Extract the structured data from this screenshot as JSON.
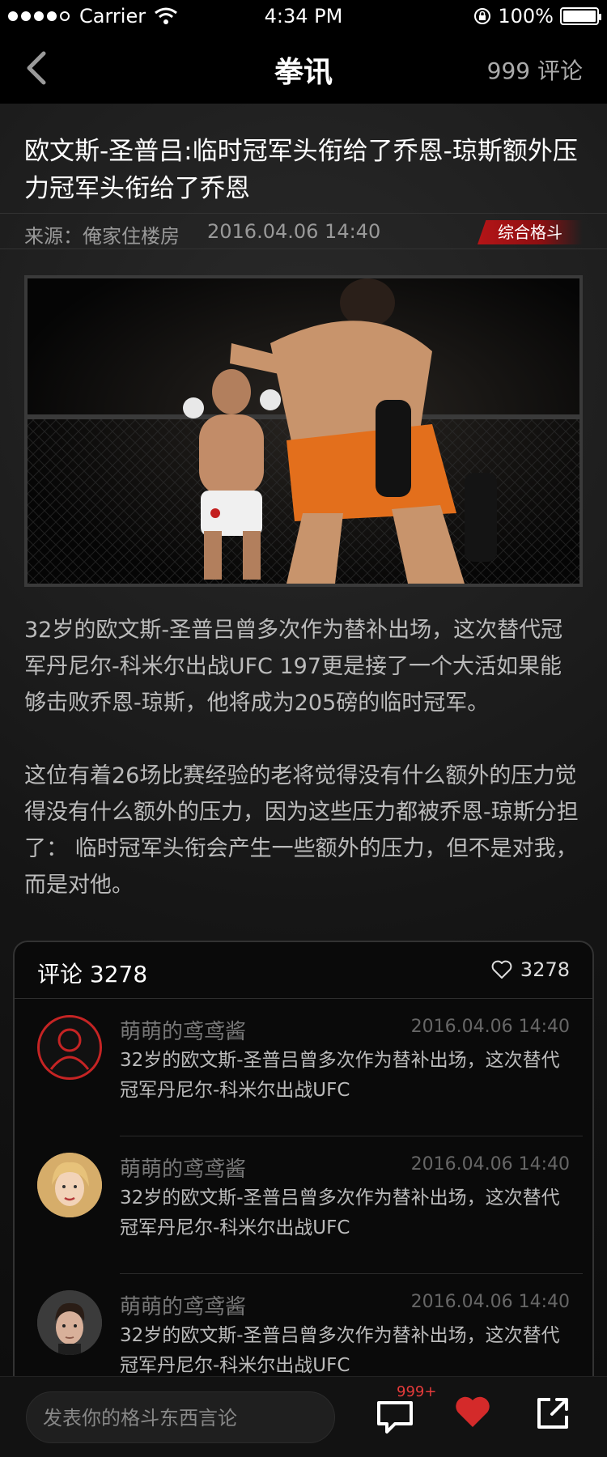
{
  "status_bar": {
    "carrier": "Carrier",
    "time": "4:34 PM",
    "battery": "100%"
  },
  "nav": {
    "title": "拳讯",
    "comments": "999 评论"
  },
  "article": {
    "headline": "欧文斯-圣普吕:临时冠军头衔给了乔恩-琼斯额外压力冠军头衔给了乔恩",
    "source": "来源：俺家住楼房",
    "date": "2016.04.06   14:40",
    "tag": "综合格斗",
    "paragraph1": "32岁的欧文斯-圣普吕曾多次作为替补出场，这次替代冠军丹尼尔-科米尔出战UFC 197更是接了一个大活如果能够击败乔恩-琼斯，他将成为205磅的临时冠军。",
    "paragraph2": "这位有着26场比赛经验的老将觉得没有什么额外的压力觉得没有什么额外的压力，因为这些压力都被乔恩-琼斯分担了：          临时冠军头衔会产生一些额外的压力，但不是对我，而是对他。"
  },
  "comments_section": {
    "title": "评论 3278",
    "likes": "3278",
    "items": [
      {
        "name": "萌萌的鸢鸢酱",
        "date": "2016.04.06   14:40",
        "text": "32岁的欧文斯-圣普吕曾多次作为替补出场，这次替代冠军丹尼尔-科米尔出战UFC",
        "avatar": "default-user-icon"
      },
      {
        "name": "萌萌的鸢鸢酱",
        "date": "2016.04.06   14:40",
        "text": "32岁的欧文斯-圣普吕曾多次作为替补出场，这次替代冠军丹尼尔-科米尔出战UFC",
        "avatar": "woman-portrait"
      },
      {
        "name": "萌萌的鸢鸢酱",
        "date": "2016.04.06   14:40",
        "text": "32岁的欧文斯-圣普吕曾多次作为替补出场，这次替代冠军丹尼尔-科米尔出战UFC",
        "avatar": "man-portrait"
      }
    ]
  },
  "bottom_bar": {
    "input_placeholder": "发表你的格斗东西言论",
    "badge": "999+"
  },
  "colors": {
    "accent": "#b51517",
    "background": "#0b0b0b"
  }
}
